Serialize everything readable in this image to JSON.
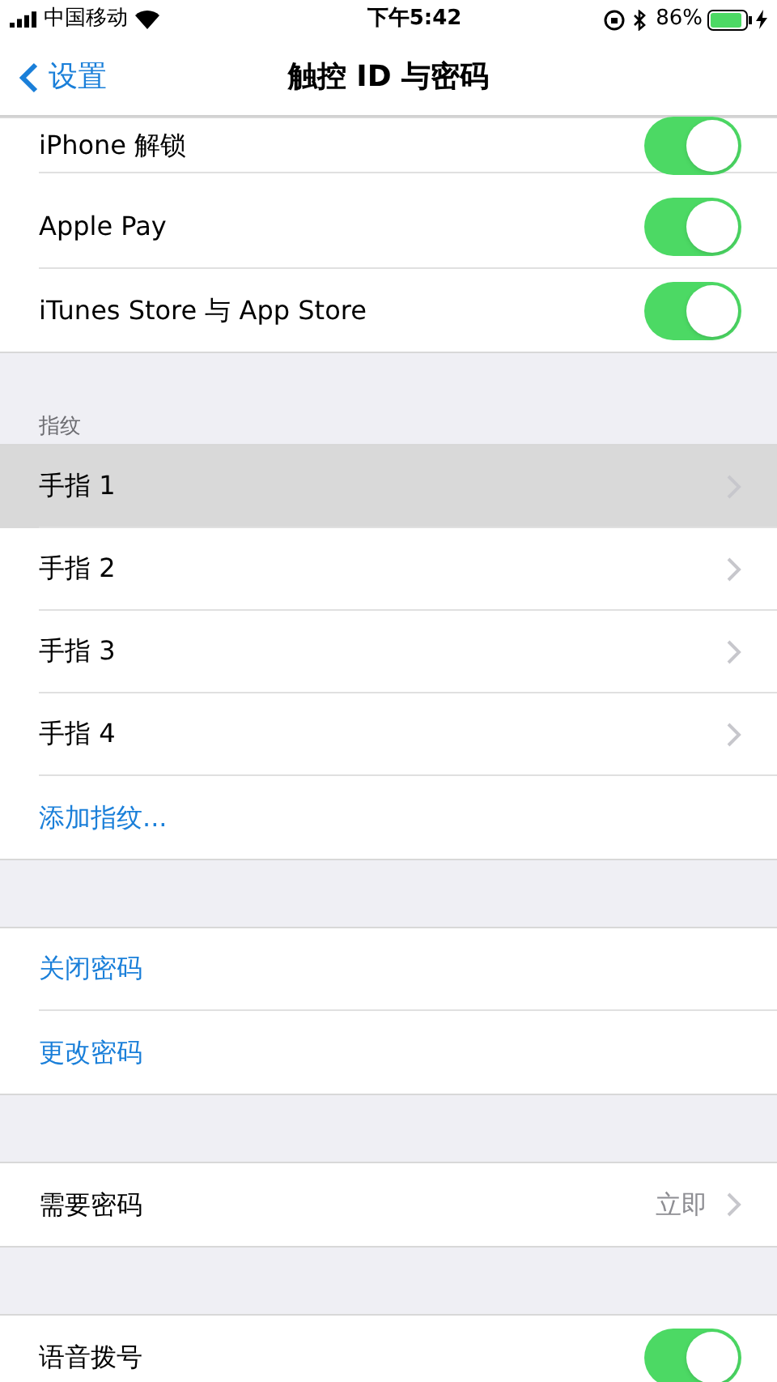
{
  "status_bar": {
    "carrier": "中国移动",
    "time": "下午5:42",
    "battery": "86%"
  },
  "nav": {
    "back": "设置",
    "title": "触控 ID 与密码"
  },
  "sections": [
    {
      "rows": [
        {
          "kind": "toggle",
          "label": "iPhone 解锁",
          "on": true,
          "selected": false
        },
        {
          "kind": "toggle",
          "label": "Apple Pay",
          "on": true,
          "selected": false
        },
        {
          "kind": "toggle",
          "label": "iTunes Store 与 App Store",
          "on": true,
          "selected": false
        }
      ]
    },
    {
      "header": "指纹",
      "rows": [
        {
          "kind": "link",
          "label": "手指 1",
          "selected": true
        },
        {
          "kind": "link",
          "label": "手指 2",
          "selected": false
        },
        {
          "kind": "link",
          "label": "手指 3",
          "selected": false
        },
        {
          "kind": "link",
          "label": "手指 4",
          "selected": false
        },
        {
          "kind": "action",
          "label": "添加指纹...",
          "selected": false
        }
      ]
    },
    {
      "rows": [
        {
          "kind": "action",
          "label": "关闭密码",
          "selected": false
        },
        {
          "kind": "action",
          "label": "更改密码",
          "selected": false
        }
      ]
    },
    {
      "rows": [
        {
          "kind": "link",
          "label": "需要密码",
          "value": "立即",
          "selected": false
        }
      ]
    },
    {
      "rows": [
        {
          "kind": "toggle",
          "label": "语音拨号",
          "on": true,
          "selected": false
        }
      ]
    }
  ]
}
